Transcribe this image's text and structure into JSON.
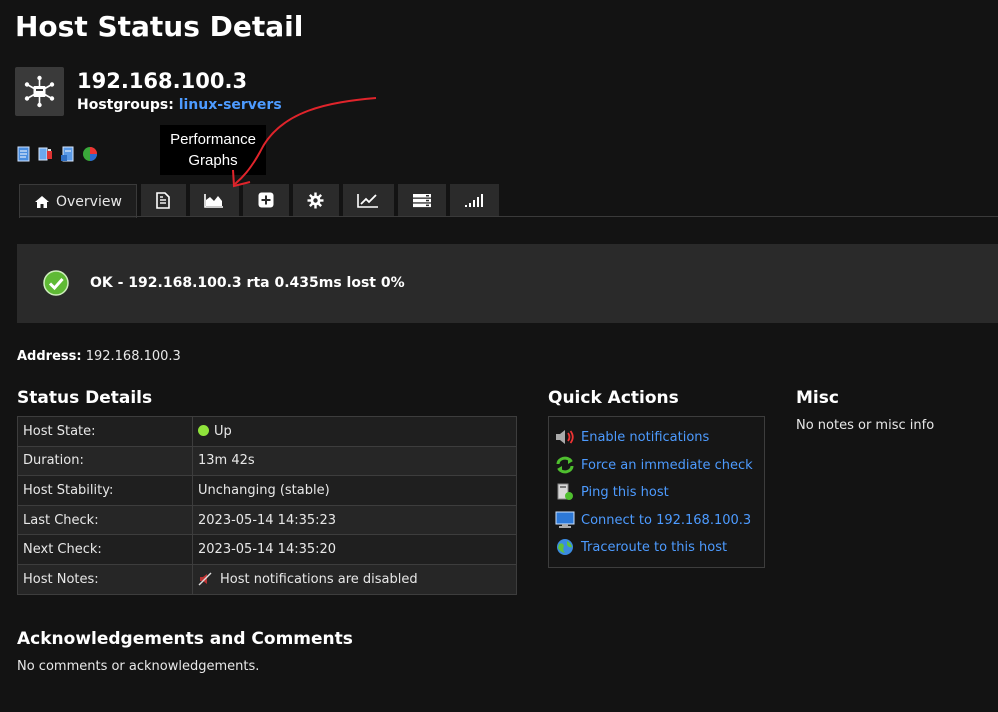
{
  "page": {
    "title": "Host Status Detail"
  },
  "host": {
    "name": "192.168.100.3",
    "hostgroups_label": "Hostgroups:",
    "hostgroup_link": "linux-servers"
  },
  "tooltip": {
    "text_line1": "Performance",
    "text_line2": "Graphs"
  },
  "tabs": [
    {
      "label": "Overview",
      "icon": "home-icon",
      "active": true
    },
    {
      "label": "",
      "icon": "document-icon"
    },
    {
      "label": "",
      "icon": "area-chart-icon"
    },
    {
      "label": "",
      "icon": "plus-square-icon"
    },
    {
      "label": "",
      "icon": "gear-icon"
    },
    {
      "label": "",
      "icon": "line-chart-icon"
    },
    {
      "label": "",
      "icon": "server-list-icon"
    },
    {
      "label": "",
      "icon": "signal-bars-icon"
    }
  ],
  "status": {
    "text": "OK - 192.168.100.3 rta 0.435ms lost 0%",
    "state_color": "#5fba35"
  },
  "address": {
    "label": "Address:",
    "value": "192.168.100.3"
  },
  "status_details": {
    "title": "Status Details",
    "rows": [
      {
        "key": "Host State:",
        "value": "Up"
      },
      {
        "key": "Duration:",
        "value": "13m 42s"
      },
      {
        "key": "Host Stability:",
        "value": "Unchanging (stable)"
      },
      {
        "key": "Last Check:",
        "value": "2023-05-14 14:35:23"
      },
      {
        "key": "Next Check:",
        "value": "2023-05-14 14:35:20"
      },
      {
        "key": "Host Notes:",
        "value": "Host notifications are disabled"
      }
    ]
  },
  "quick_actions": {
    "title": "Quick Actions",
    "items": [
      {
        "label": "Enable notifications",
        "icon": "speaker-icon"
      },
      {
        "label": "Force an immediate check",
        "icon": "refresh-icon"
      },
      {
        "label": "Ping this host",
        "icon": "ping-icon"
      },
      {
        "label": "Connect to 192.168.100.3",
        "icon": "monitor-icon"
      },
      {
        "label": "Traceroute to this host",
        "icon": "globe-icon"
      }
    ]
  },
  "misc": {
    "title": "Misc",
    "text": "No notes or misc info"
  },
  "acknowledgements": {
    "title": "Acknowledgements and Comments",
    "text": "No comments or acknowledgements."
  },
  "colors": {
    "link": "#4d9bff",
    "up": "#8fe33b",
    "annotation": "#e0242b"
  }
}
